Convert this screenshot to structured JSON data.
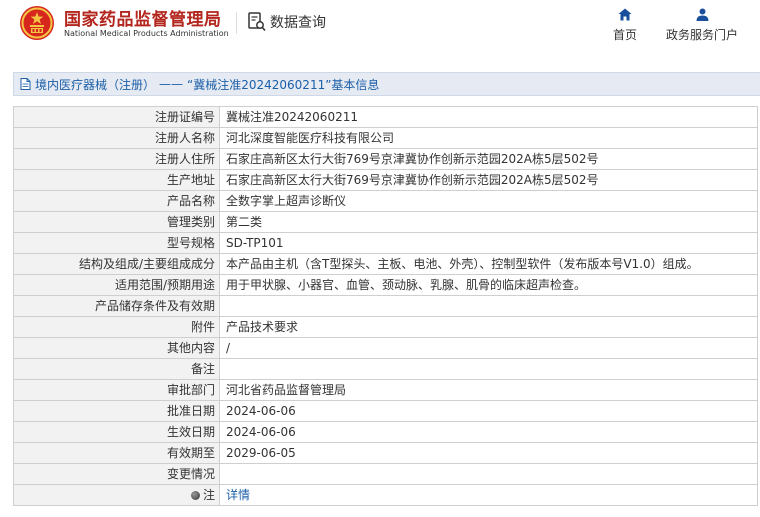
{
  "header": {
    "brand_cn": "国家药品监督管理局",
    "brand_en": "National Medical Products Administration",
    "query_label": "数据查询",
    "nav": [
      {
        "label": "首页",
        "icon": "home-icon"
      },
      {
        "label": "政务服务门户",
        "icon": "user-icon"
      }
    ]
  },
  "breadcrumb": {
    "category": "境内医疗器械（注册）",
    "separator": "——",
    "title": "“冀械注准20242060211”基本信息"
  },
  "colors": {
    "brand_red": "#b3261e",
    "link_blue": "#1c5fa8",
    "nav_blue": "#1a4f9c",
    "breadcrumb_bg": "#e6ebf3",
    "label_bg": "#f2f2f2"
  },
  "rows": [
    {
      "label": "注册证编号",
      "value": "冀械注准20242060211"
    },
    {
      "label": "注册人名称",
      "value": "河北深度智能医疗科技有限公司"
    },
    {
      "label": "注册人住所",
      "value": "石家庄高新区太行大街769号京津冀协作创新示范园202A栋5层502号"
    },
    {
      "label": "生产地址",
      "value": "石家庄高新区太行大街769号京津冀协作创新示范园202A栋5层502号"
    },
    {
      "label": "产品名称",
      "value": "全数字掌上超声诊断仪"
    },
    {
      "label": "管理类别",
      "value": "第二类"
    },
    {
      "label": "型号规格",
      "value": "SD-TP101"
    },
    {
      "label": "结构及组成/主要组成成分",
      "value": "本产品由主机（含T型探头、主板、电池、外壳）、控制型软件（发布版本号V1.0）组成。"
    },
    {
      "label": "适用范围/预期用途",
      "value": "用于甲状腺、小器官、血管、颈动脉、乳腺、肌骨的临床超声检查。"
    },
    {
      "label": "产品储存条件及有效期",
      "value": ""
    },
    {
      "label": "附件",
      "value": "产品技术要求"
    },
    {
      "label": "其他内容",
      "value": "/"
    },
    {
      "label": "备注",
      "value": ""
    },
    {
      "label": "审批部门",
      "value": "河北省药品监督管理局"
    },
    {
      "label": "批准日期",
      "value": "2024-06-06"
    },
    {
      "label": "生效日期",
      "value": "2024-06-06"
    },
    {
      "label": "有效期至",
      "value": "2029-06-05"
    },
    {
      "label": "变更情况",
      "value": ""
    }
  ],
  "note_row": {
    "label": "注",
    "value": "详情"
  }
}
